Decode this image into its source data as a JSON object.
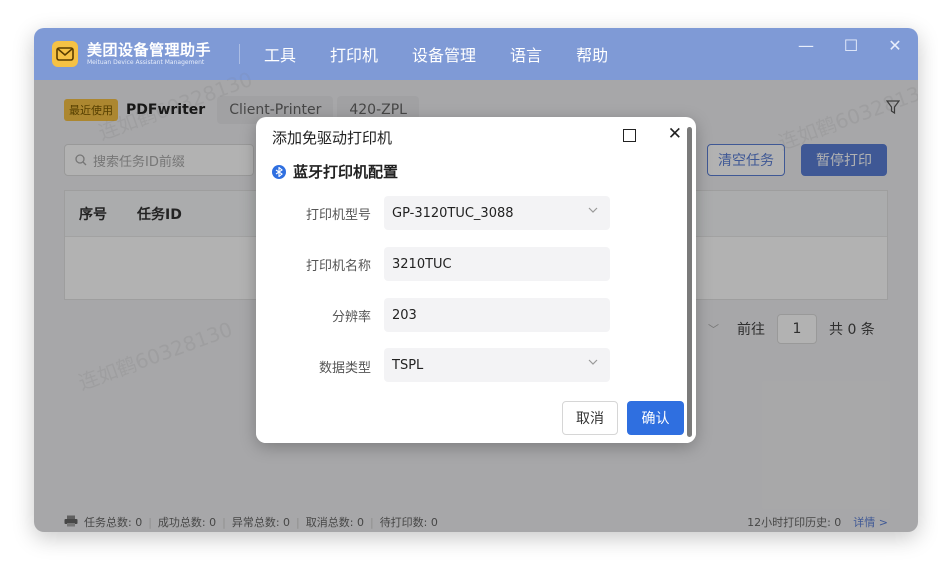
{
  "app": {
    "name": "美团设备管理助手",
    "subtitle": "Meituan Device Assistant Management",
    "menu": [
      "工具",
      "打印机",
      "设备管理",
      "语言",
      "帮助"
    ]
  },
  "window_controls": {
    "minimize": "—",
    "maximize": "☐",
    "close": "✕"
  },
  "tabs": {
    "recent_badge": "最近使用",
    "items": [
      "PDFwriter",
      "Client-Printer",
      "420-ZPL"
    ]
  },
  "toolbar": {
    "search_placeholder": "搜索任务ID前缀",
    "clear_tasks": "清空任务",
    "pause_print": "暂停打印"
  },
  "table": {
    "headers": [
      "序号",
      "任务ID"
    ]
  },
  "pager": {
    "goto": "前往",
    "page": "1",
    "total": "共 0 条"
  },
  "footer": {
    "stats": [
      "任务总数: 0",
      "成功总数: 0",
      "异常总数: 0",
      "取消总数: 0",
      "待打印数: 0"
    ],
    "history": "12小时打印历史: 0",
    "detail": "详情 >"
  },
  "watermark_text": "连如鹤60328130",
  "dialog": {
    "title": "添加免驱动打印机",
    "section": "蓝牙打印机配置",
    "fields": [
      {
        "label": "打印机型号",
        "value": "GP-3120TUC_3088",
        "dropdown": true
      },
      {
        "label": "打印机名称",
        "value": "3210TUC",
        "dropdown": false
      },
      {
        "label": "分辨率",
        "value": "203",
        "dropdown": false
      },
      {
        "label": "数据类型",
        "value": "TSPL",
        "dropdown": true
      }
    ],
    "cancel": "取消",
    "confirm": "确认"
  },
  "colors": {
    "titlebar": "#7f9ad6",
    "accent": "#5b7fd6",
    "primary_button": "#2f6fe0",
    "logo": "#f6c245"
  }
}
